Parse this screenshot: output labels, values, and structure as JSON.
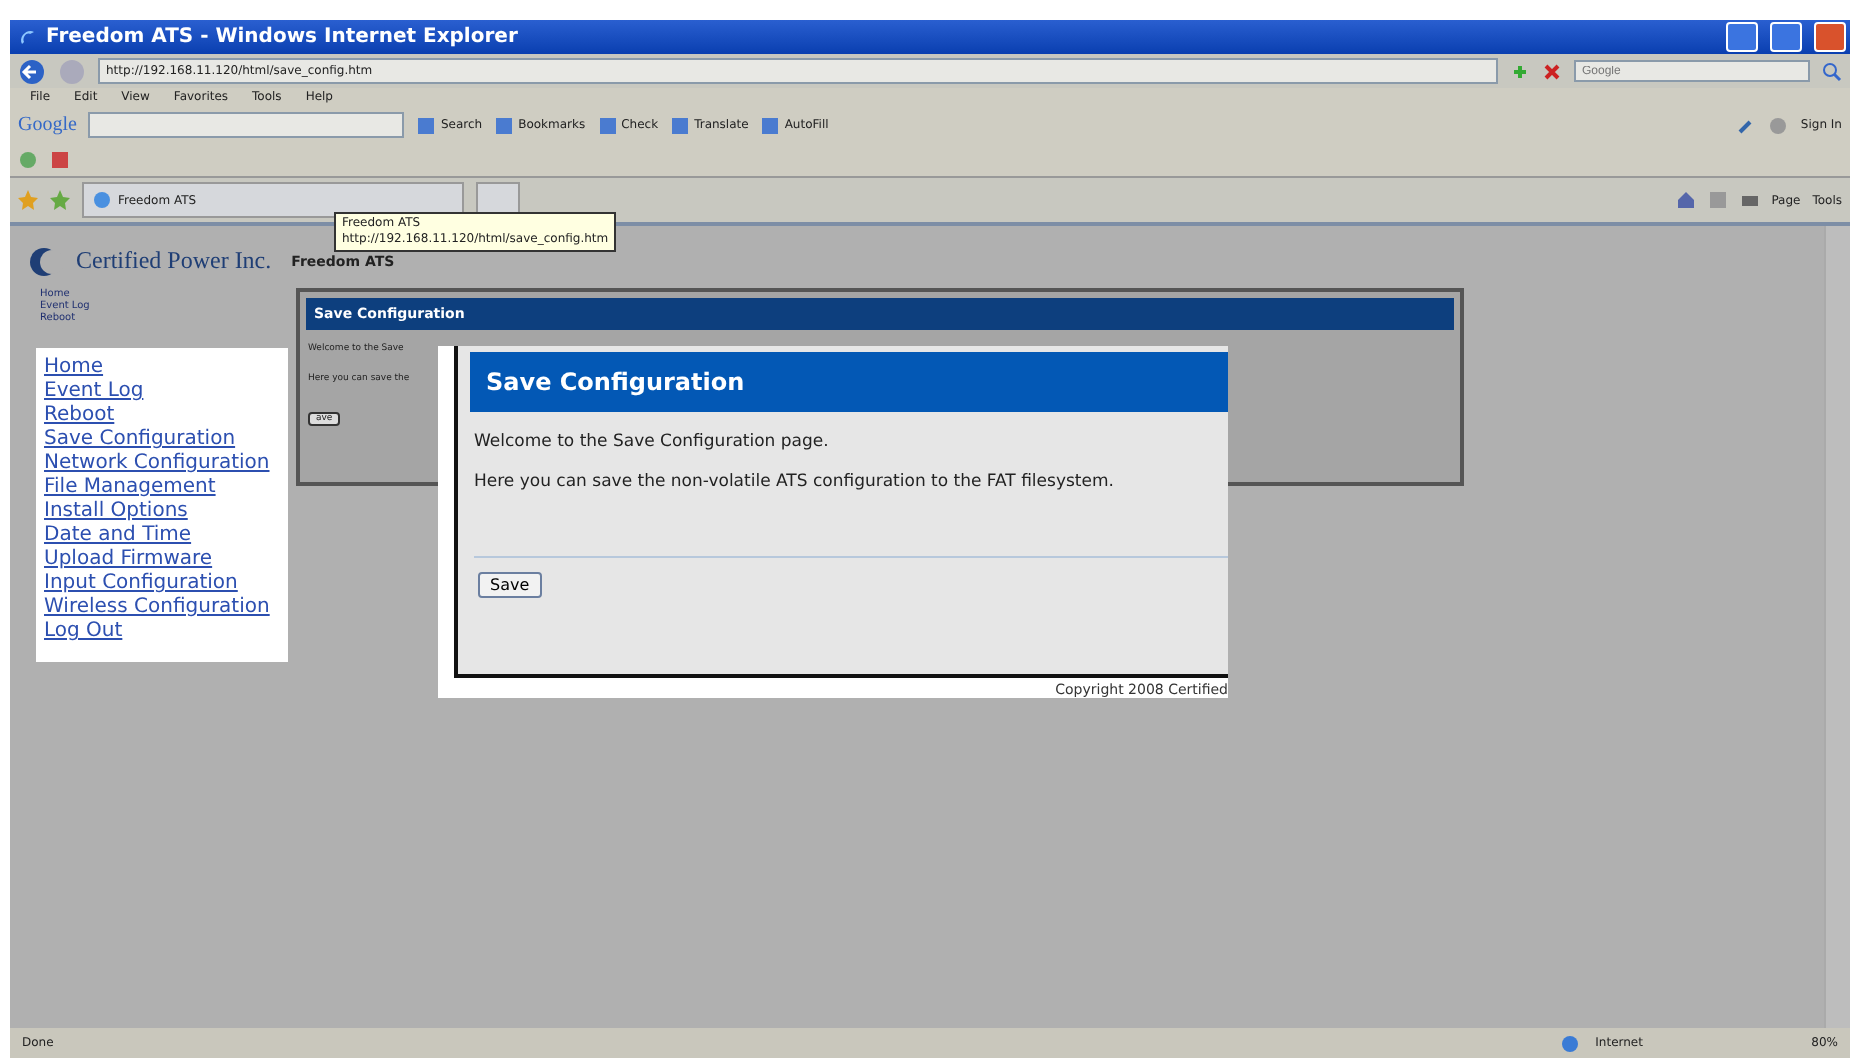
{
  "window": {
    "title": "Freedom ATS - Windows Internet Explorer"
  },
  "address_bar": {
    "value": "http://192.168.11.120/html/save_config.htm"
  },
  "search_box": {
    "placeholder": "Google"
  },
  "menu": [
    "File",
    "Edit",
    "View",
    "Favorites",
    "Tools",
    "Help"
  ],
  "google_toolbar": {
    "logo": "Google",
    "items": [
      "Search",
      "Bookmarks",
      "Check",
      "Translate",
      "AutoFill"
    ],
    "sign_in": "Sign In"
  },
  "tab": {
    "label": "Freedom ATS"
  },
  "tooltip": {
    "title": "Freedom ATS",
    "url": "http://192.168.11.120/html/save_config.htm"
  },
  "command_bar": [
    "Page",
    "Tools"
  ],
  "page": {
    "logo": "Certified Power Inc.",
    "site_title": "Freedom ATS",
    "nav": [
      "Home",
      "Event Log",
      "Reboot"
    ],
    "panel_title": "Save Configuration",
    "fragments": [
      "Welcome to the Save",
      "Here you can save the"
    ],
    "button": "ave"
  },
  "nav_callout": {
    "links": [
      "Home",
      "Event Log",
      "Reboot",
      "Save Configuration",
      "Network Configuration",
      "File Management",
      "Install Options",
      "Date and Time",
      "Upload Firmware",
      "Input Configuration",
      "Wireless Configuration",
      "Log Out"
    ]
  },
  "save_callout": {
    "title": "Save Configuration",
    "paragraphs": [
      "Welcome to the Save Configuration page.",
      "Here you can save the non-volatile ATS configuration to the FAT filesystem."
    ],
    "button": "Save",
    "footer": "Copyright 2008 Certified"
  },
  "status_bar": {
    "text": "Done",
    "zone": "Internet",
    "zoom": "80%"
  }
}
